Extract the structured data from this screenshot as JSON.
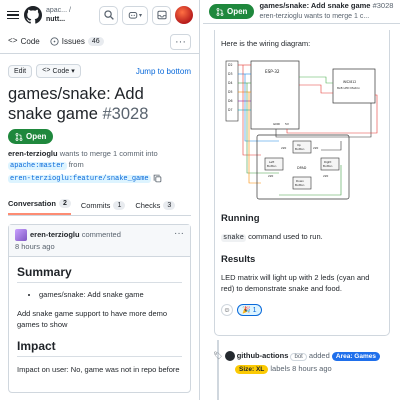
{
  "left": {
    "header": {
      "repo_owner": "apac...",
      "repo_name": "nutt...",
      "repo_owner_suffix": "/"
    },
    "reponav": {
      "code_label": "Code",
      "issues_label": "Issues",
      "issues_count": "46"
    },
    "actions": {
      "edit_label": "Edit",
      "code_label": "Code",
      "jump_label": "Jump to bottom"
    },
    "pr": {
      "title": "games/snake: Add snake game",
      "number": "#3028",
      "status": "Open",
      "author": "eren-terziogl",
      "author_full": "eren-terzioglu",
      "merge_text": "wants to merge 1 commit into",
      "base_branch": "apache:master",
      "from_text": "from",
      "head_branch": "eren-terzioglu:feature/snake_game"
    },
    "tabs": [
      {
        "label": "Conversation",
        "count": "2"
      },
      {
        "label": "Commits",
        "count": "1"
      },
      {
        "label": "Checks",
        "count": "3"
      }
    ],
    "comment": {
      "author": "eren-terzioglu",
      "action": "commented",
      "time": "8 hours ago",
      "summary_heading": "Summary",
      "summary_item": "games/snake: Add snake game",
      "summary_para": "Add snake game support to have more demo games to show",
      "impact_heading": "Impact",
      "impact_para": "Impact on user: No, game was not in repo before"
    }
  },
  "right": {
    "sticky": {
      "status": "Open",
      "title": "games/snake: Add snake game",
      "number": "#3028",
      "subtitle": "eren-terzioglu wants to merge 1 c..."
    },
    "body": {
      "wiring_intro": "Here is the wiring diagram:",
      "running_heading": "Running",
      "command": "snake",
      "command_suffix": "command used to run.",
      "results_heading": "Results",
      "results_para": "LED matrix will light up with 2 leds (cyan and red) to demonstrate snake and food.",
      "reaction_count": "1"
    },
    "diagram": {
      "esp_label": "ESP-32",
      "matrix_label": "WS2812\n8x8 LED Matrix",
      "pins": [
        "D2",
        "D3",
        "D4",
        "D5",
        "D6",
        "D7"
      ],
      "up": "Up\nButton",
      "left": "Left\nButton",
      "right": "Right\nButton",
      "down": "Down\nButton",
      "dpad": "DPAD",
      "gnd": "GND",
      "v5": "5V",
      "r": "220"
    },
    "event": {
      "actor": "github-actions",
      "bot_label": "bot",
      "verb": "added",
      "label1": "Area: Games",
      "label2": "Size: XL",
      "suffix": "labels 8 hours ago"
    }
  }
}
